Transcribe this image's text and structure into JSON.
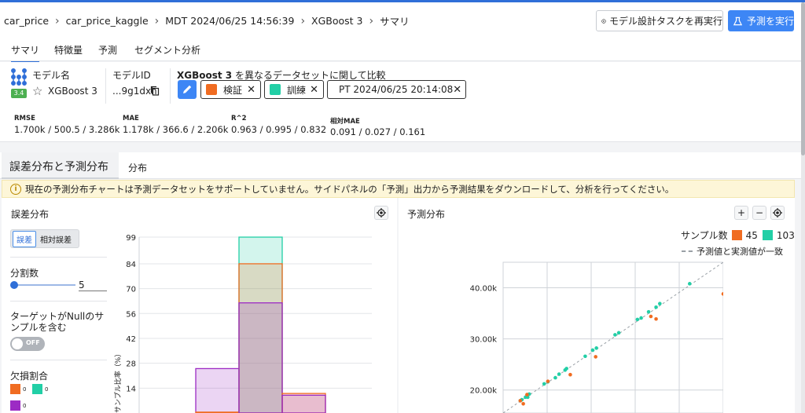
{
  "breadcrumb": [
    "car_price",
    "car_price_kaggle",
    "MDT 2024/06/25 14:56:39",
    "XGBoost 3",
    "サマリ"
  ],
  "header": {
    "rerun_label": "モデル設計タスクを再実行",
    "predict_label": "予測を実行"
  },
  "tabs": [
    "サマリ",
    "特徴量",
    "予測",
    "セグメント分析"
  ],
  "model": {
    "name_label": "モデル名",
    "version_badge": "3.4",
    "name": "XGBoost 3",
    "id_label": "モデルID",
    "id_value": "...9g1dxh",
    "compare_model": "XGBoost 3",
    "compare_text": "を異なるデータセットに関して比較",
    "datasets": [
      {
        "label": "検証",
        "color": "#f06c21"
      },
      {
        "label": "訓練",
        "color": "#22cfa6"
      },
      {
        "label": "PT 2024/06/25 20:14:08",
        "color": "#9c2bc4"
      }
    ]
  },
  "metrics": [
    {
      "label": "RMSE",
      "value": "1.700k / 500.5 / 3.286k"
    },
    {
      "label": "MAE",
      "value": "1.178k / 366.6 / 2.206k"
    },
    {
      "label": "R^2",
      "value": "0.963 / 0.995 / 0.832"
    },
    {
      "label": "相対MAE",
      "value": "0.091 / 0.027 / 0.161"
    }
  ],
  "section": {
    "title": "誤差分布と予測分布",
    "tab": "分布"
  },
  "warning": "現在の予測分布チャートは予測データセットをサポートしていません。サイドパネルの「予測」出力から予測結果をダウンロードして、分析を行ってください。",
  "error_panel": {
    "title": "誤差分布",
    "seg_options": [
      "誤差",
      "相対誤差"
    ],
    "bins_label": "分割数",
    "bins_value": "5",
    "bins_slider_fraction": 0.0,
    "null_label": "ターゲットがNullのサンプルを含む",
    "toggle_state": "OFF",
    "missing_label": "欠損割合",
    "missing_items": [
      {
        "color": "#f06c21",
        "value": "0"
      },
      {
        "color": "#22cfa6",
        "value": "0"
      },
      {
        "color": "#9c2bc4",
        "value": "0"
      }
    ]
  },
  "pred_panel": {
    "title": "予測分布",
    "sample_label": "サンプル数",
    "sample_counts": [
      {
        "color": "#f06c21",
        "value": "45"
      },
      {
        "color": "#22cfa6",
        "value": "103"
      }
    ],
    "match_label": "予測値と実測値が一致"
  },
  "chart_data": [
    {
      "type": "bar",
      "ylabel": "サンプル比率（%）",
      "y_ticks": [
        "99",
        "84",
        "70",
        "56",
        "42",
        "28",
        "14"
      ],
      "ylim": [
        0,
        99
      ],
      "grid": true,
      "bins": [
        {
          "series": [
            {
              "color": "#9c2bc4",
              "value": 25
            },
            {
              "color": "#f06c21",
              "value": 0.5
            }
          ]
        },
        {
          "series": [
            {
              "color": "#22cfa6",
              "value": 99
            },
            {
              "color": "#f06c21",
              "value": 84
            },
            {
              "color": "#9c2bc4",
              "value": 62
            }
          ]
        },
        {
          "series": [
            {
              "color": "#f06c21",
              "value": 11
            },
            {
              "color": "#9c2bc4",
              "value": 10
            }
          ]
        }
      ]
    },
    {
      "type": "scatter",
      "y_ticks": [
        "40.00k",
        "30.00k",
        "20.00k"
      ],
      "ylim": [
        15500,
        45000
      ],
      "xlim": [
        15500,
        45000
      ],
      "grid": true,
      "series": [
        {
          "color": "#22cfa6",
          "points": [
            [
              40500,
              40800
            ],
            [
              36500,
              36900
            ],
            [
              36000,
              36200
            ],
            [
              35000,
              35300
            ],
            [
              34000,
              34100
            ],
            [
              33500,
              33800
            ],
            [
              31000,
              31200
            ],
            [
              30500,
              30800
            ],
            [
              28000,
              28200
            ],
            [
              27500,
              27800
            ],
            [
              26500,
              26600
            ],
            [
              24000,
              24200
            ],
            [
              23800,
              23900
            ],
            [
              23000,
              23100
            ],
            [
              22500,
              22400
            ],
            [
              21500,
              21600
            ],
            [
              21000,
              21200
            ],
            [
              19000,
              19200
            ],
            [
              18800,
              18600
            ],
            [
              18500,
              18600
            ],
            [
              18000,
              18100
            ],
            [
              17800,
              17900
            ]
          ]
        },
        {
          "color": "#f06c21",
          "points": [
            [
              45000,
              38800
            ],
            [
              35300,
              34400
            ],
            [
              36000,
              33900
            ],
            [
              27900,
              26500
            ],
            [
              24500,
              23000
            ],
            [
              21500,
              21700
            ],
            [
              18700,
              19100
            ],
            [
              17800,
              17900
            ],
            [
              18200,
              17300
            ]
          ]
        }
      ]
    }
  ]
}
